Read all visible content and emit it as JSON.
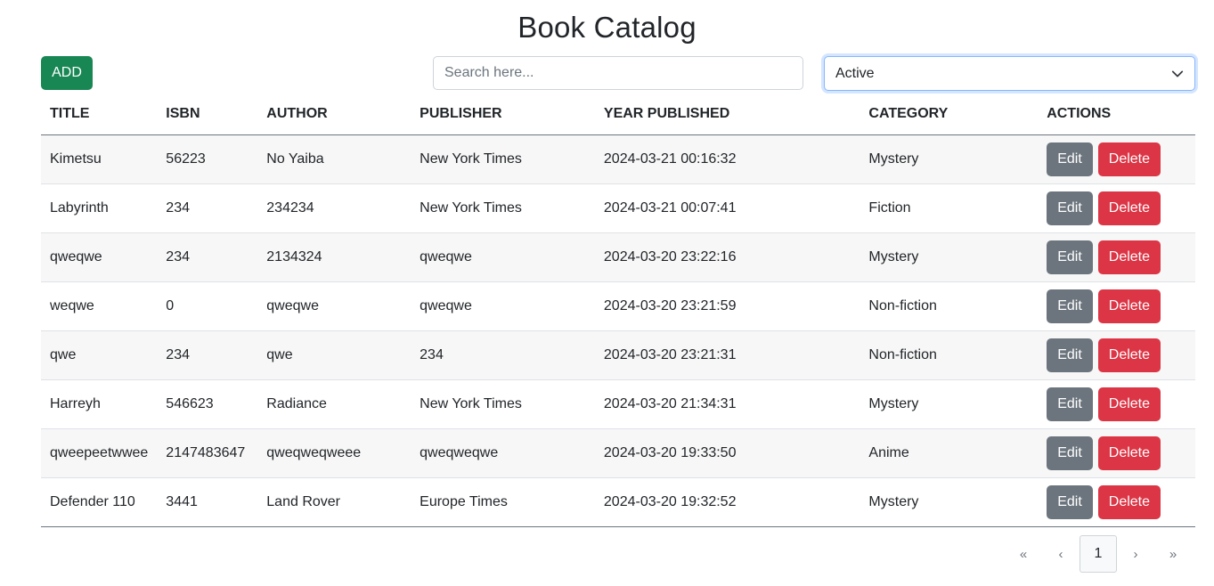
{
  "header": {
    "title": "Book Catalog"
  },
  "toolbar": {
    "add_label": "ADD",
    "search_placeholder": "Search here...",
    "status_selected": "Active"
  },
  "table": {
    "columns": [
      "TITLE",
      "ISBN",
      "AUTHOR",
      "PUBLISHER",
      "YEAR PUBLISHED",
      "CATEGORY",
      "ACTIONS"
    ],
    "rows": [
      {
        "title": "Kimetsu",
        "isbn": "56223",
        "author": "No Yaiba",
        "publisher": "New York Times",
        "year": "2024-03-21 00:16:32",
        "category": "Mystery"
      },
      {
        "title": "Labyrinth",
        "isbn": "234",
        "author": "234234",
        "publisher": "New York Times",
        "year": "2024-03-21 00:07:41",
        "category": "Fiction"
      },
      {
        "title": "qweqwe",
        "isbn": "234",
        "author": "2134324",
        "publisher": "qweqwe",
        "year": "2024-03-20 23:22:16",
        "category": "Mystery"
      },
      {
        "title": "weqwe",
        "isbn": "0",
        "author": "qweqwe",
        "publisher": "qweqwe",
        "year": "2024-03-20 23:21:59",
        "category": "Non-fiction"
      },
      {
        "title": "qwe",
        "isbn": "234",
        "author": "qwe",
        "publisher": "234",
        "year": "2024-03-20 23:21:31",
        "category": "Non-fiction"
      },
      {
        "title": "Harreyh",
        "isbn": "546623",
        "author": "Radiance",
        "publisher": "New York Times",
        "year": "2024-03-20 21:34:31",
        "category": "Mystery"
      },
      {
        "title": "qweepeetwwee",
        "isbn": "2147483647",
        "author": "qweqweqweee",
        "publisher": "qweqweqwe",
        "year": "2024-03-20 19:33:50",
        "category": "Anime"
      },
      {
        "title": "Defender 110",
        "isbn": "3441",
        "author": "Land Rover",
        "publisher": "Europe Times",
        "year": "2024-03-20 19:32:52",
        "category": "Mystery"
      }
    ],
    "edit_label": "Edit",
    "delete_label": "Delete"
  },
  "pagination": {
    "first": "«",
    "prev": "‹",
    "current": "1",
    "next": "›",
    "last": "»"
  },
  "colors": {
    "add": "#198754",
    "edit": "#6c757d",
    "delete": "#dc3545",
    "focus": "#86b7fe"
  },
  "icons": {
    "select_caret": "chevron-down-icon"
  }
}
